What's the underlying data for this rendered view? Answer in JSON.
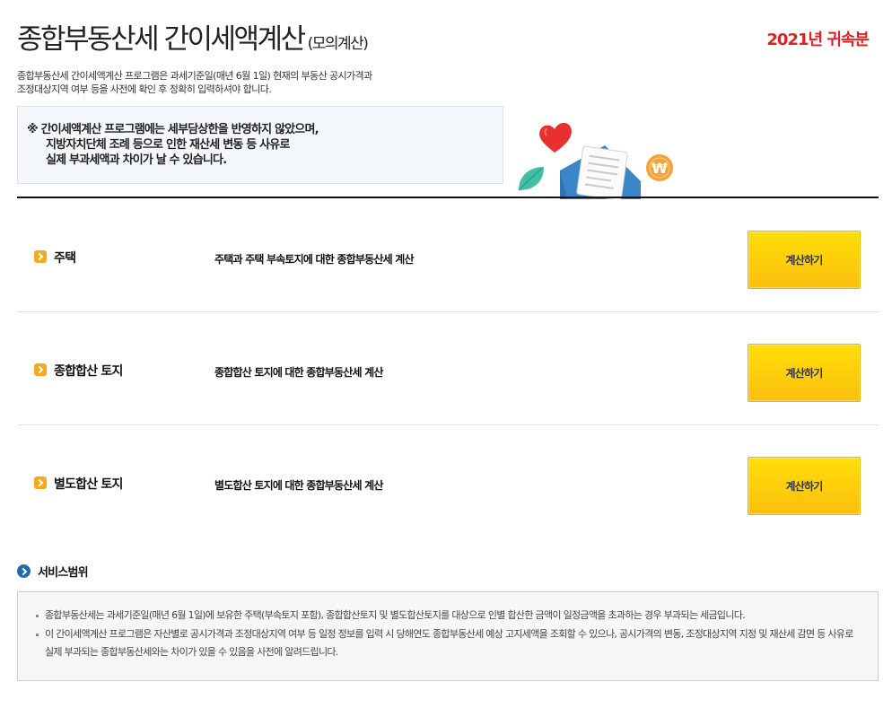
{
  "header": {
    "title": "종합부동산세 간이세액계산",
    "title_sub": "(모의계산)",
    "year_label": "2021년 귀속분"
  },
  "intro": {
    "line1": "종합부동산세 간이세액계산 프로그램은 과세기준일(매년 6월 1일) 현재의 부동산 공시가격과",
    "line2": "조정대상지역 여부 등을 사전에 확인 후 정확히 입력하셔야 합니다."
  },
  "notice": {
    "line1": "※ 간이세액계산 프로그램에는 세부담상한을 반영하지 않았으며,",
    "line2": "지방자치단체 조례 등으로 인한 재산세 변동 등 사유로",
    "line3": "실제 부과세액과 차이가 날 수 있습니다."
  },
  "rows": [
    {
      "name": "주택",
      "desc": "주택과 주택 부속토지에 대한 종합부동산세 계산",
      "button": "계산하기"
    },
    {
      "name": "종합합산 토지",
      "desc": "종합합산 토지에 대한 종합부동산세 계산",
      "button": "계산하기"
    },
    {
      "name": "별도합산 토지",
      "desc": "별도합산 토지에 대한 종합부동산세 계산",
      "button": "계산하기"
    }
  ],
  "service": {
    "title": "서비스범위",
    "items": [
      "종합부동산세는 과세기준일(매년 6월 1일)에 보유한 주택(부속토지 포함), 종합합산토지 및 별도합산토지를 대상으로 인별 합산한 금액이 일정금액을 초과하는 경우 부과되는 세금입니다.",
      "이 간이세액계산 프로그램은 자산별로 공시가격과 조정대상지역 여부 등 일정 정보를 입력 시 당해연도 종합부동산세 예상 고지세액을 조회할 수 있으나, 공시가격의 변동, 조정대상지역 지정 및 재산세 감면 등 사유로 실제 부과되는 종합부동산세와는 차이가 있을 수 있음을 사전에 알려드립니다."
    ]
  },
  "colors": {
    "year_red": "#e31e24",
    "button_yellow": "#fdcb0b",
    "row_icon_orange": "#f4a91f",
    "service_icon_blue": "#1f6cab"
  },
  "icons": {
    "row_bullet": "chevron-right-icon",
    "service_bullet": "arrow-circle-icon",
    "illustration": [
      "heart-icon",
      "leaf-icon",
      "document-icon",
      "won-coin-icon"
    ]
  }
}
